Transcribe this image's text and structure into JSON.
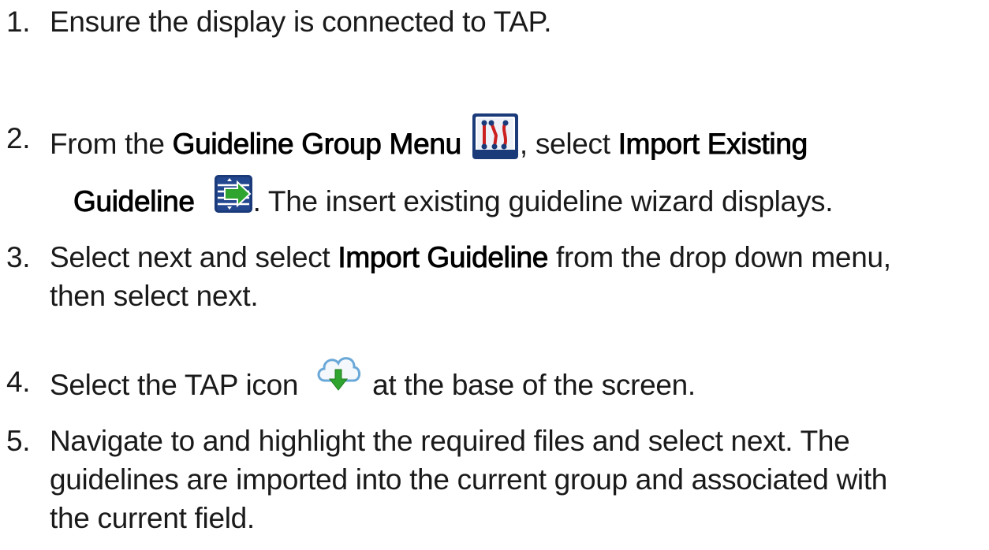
{
  "steps": [
    {
      "number": "1.",
      "line1": "Ensure the display is connected to TAP."
    },
    {
      "number": "2.",
      "pre": "From the ",
      "bold1": "Guideline Group Menu",
      "mid": ", select ",
      "bold2a": "Import Existing",
      "bold2b": "Guideline",
      "post": ". The insert existing guideline wizard displays.",
      "icon1": "guideline-group-menu-icon",
      "icon2": "import-existing-guideline-icon"
    },
    {
      "number": "3.",
      "pre": "Select next and select ",
      "bold": "Import Guideline",
      "post": " from the drop down menu,",
      "line2": "then select next."
    },
    {
      "number": "4.",
      "pre": "Select the TAP icon",
      "post": "at the base of the screen.",
      "icon": "tap-cloud-download-icon"
    },
    {
      "number": "5.",
      "line1": "Navigate to and highlight the required files and select next. The",
      "line2": "guidelines are imported into the current group and associated with",
      "line3": "the current field."
    }
  ],
  "colors": {
    "text": "#1a1a1a",
    "icon_red": "#cc1f1f",
    "icon_navy": "#1a3a7a",
    "icon_green": "#2fa52f",
    "icon_cloud": "#6aa8d8"
  }
}
